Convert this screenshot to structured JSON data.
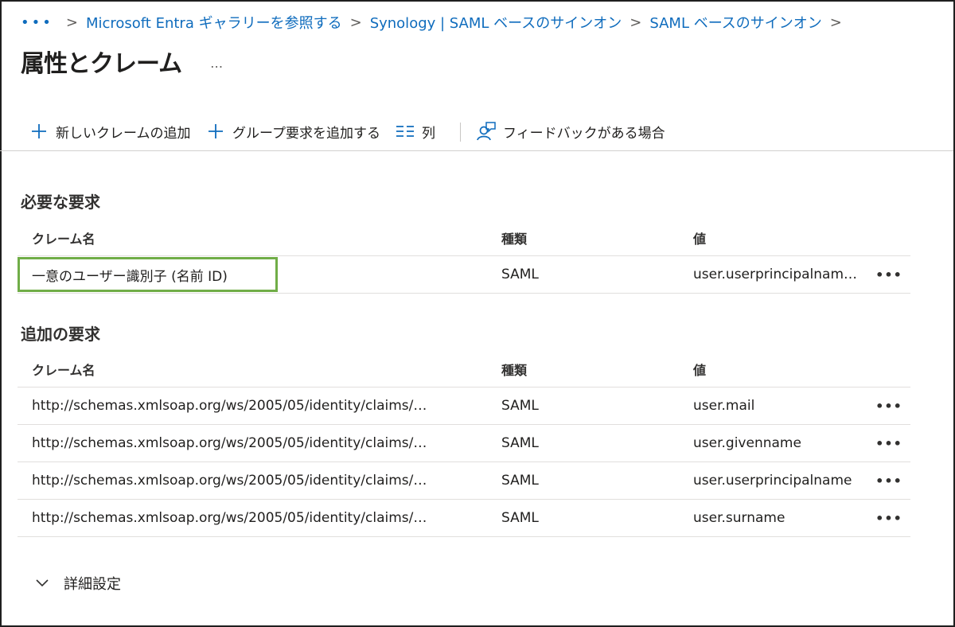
{
  "breadcrumb": {
    "overflow": "•••",
    "items": [
      "Microsoft Entra ギャラリーを参照する",
      "Synology | SAML ベースのサインオン",
      "SAML ベースのサインオン"
    ],
    "separator": ">"
  },
  "page": {
    "title": "属性とクレーム",
    "more": "…"
  },
  "toolbar": {
    "add_claim": "新しいクレームの追加",
    "add_group_claim": "グループ要求を追加する",
    "columns": "列",
    "feedback": "フィードバックがある場合"
  },
  "required": {
    "title": "必要な要求",
    "headers": {
      "name": "クレーム名",
      "type": "種類",
      "value": "値"
    },
    "rows": [
      {
        "name": "一意のユーザー識別子 (名前 ID)",
        "type": "SAML",
        "value": "user.userprincipalnam…",
        "more": "•••"
      }
    ]
  },
  "additional": {
    "title": "追加の要求",
    "headers": {
      "name": "クレーム名",
      "type": "種類",
      "value": "値"
    },
    "rows": [
      {
        "name": "http://schemas.xmlsoap.org/ws/2005/05/identity/claims/…",
        "type": "SAML",
        "value": "user.mail",
        "more": "•••"
      },
      {
        "name": "http://schemas.xmlsoap.org/ws/2005/05/identity/claims/…",
        "type": "SAML",
        "value": "user.givenname",
        "more": "•••"
      },
      {
        "name": "http://schemas.xmlsoap.org/ws/2005/05/identity/claims/…",
        "type": "SAML",
        "value": "user.userprincipalname",
        "more": "•••"
      },
      {
        "name": "http://schemas.xmlsoap.org/ws/2005/05/identity/claims/…",
        "type": "SAML",
        "value": "user.surname",
        "more": "•••"
      }
    ]
  },
  "advanced": {
    "label": "詳細設定"
  },
  "colors": {
    "link": "#0f6cbd",
    "highlight": "#70ad47",
    "text": "#201f1e"
  }
}
